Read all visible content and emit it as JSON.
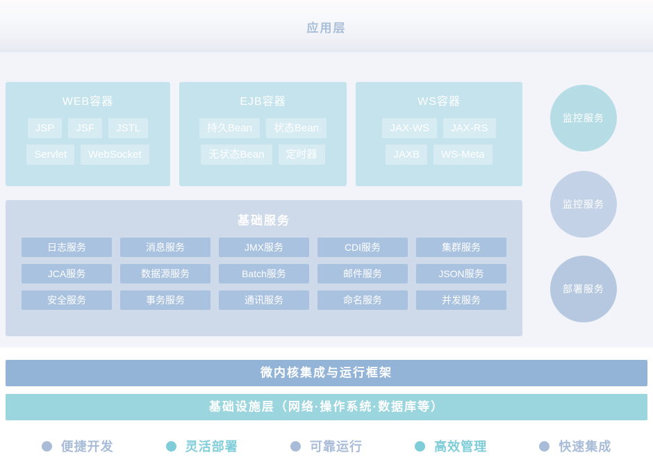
{
  "header": {
    "title": "应用层"
  },
  "containers": [
    {
      "name": "web-container",
      "title": "WEB容器",
      "rows": [
        [
          "JSP",
          "JSF",
          "JSTL"
        ],
        [
          "Servlet",
          "WebSocket"
        ]
      ]
    },
    {
      "name": "ejb-container",
      "title": "EJB容器",
      "rows": [
        [
          "持久Bean",
          "状态Bean"
        ],
        [
          "无状态Bean",
          "定时器"
        ]
      ]
    },
    {
      "name": "ws-container",
      "title": "WS容器",
      "rows": [
        [
          "JAX-WS",
          "JAX-RS"
        ],
        [
          "JAXB",
          "WS-Meta"
        ]
      ]
    }
  ],
  "basic_services": {
    "title": "基础服务",
    "rows": [
      [
        "日志服务",
        "消息服务",
        "JMX服务",
        "CDI服务",
        "集群服务"
      ],
      [
        "JCA服务",
        "数据源服务",
        "Batch服务",
        "邮件服务",
        "JSON服务"
      ],
      [
        "安全服务",
        "事务服务",
        "通讯服务",
        "命名服务",
        "并发服务"
      ]
    ]
  },
  "side_circles": [
    {
      "label": "监控服务",
      "color": "#b6dde6"
    },
    {
      "label": "监控服务",
      "color": "#c3d2e6"
    },
    {
      "label": "部署服务",
      "color": "#b5c8e0"
    }
  ],
  "bars": [
    {
      "label": "微内核集成与运行框架",
      "color": "#94b4d7"
    },
    {
      "label": "基础设施层（网络·操作系统·数据库等）",
      "color": "#9bd5dd"
    }
  ],
  "footer_features": [
    {
      "label": "便捷开发",
      "color": "#a8bcd8"
    },
    {
      "label": "灵活部署",
      "color": "#7fcdd8"
    },
    {
      "label": "可靠运行",
      "color": "#a8bcd8"
    },
    {
      "label": "高效管理",
      "color": "#7fcdd8"
    },
    {
      "label": "快速集成",
      "color": "#a8bcd8"
    }
  ],
  "colors": {
    "header_text": "#a9bed9",
    "body_background": "#f3f4f9",
    "container_fill": "#c5e3ec",
    "basic_panel_fill": "#ced9ea",
    "basic_tag_fill": "#a9c2df"
  }
}
